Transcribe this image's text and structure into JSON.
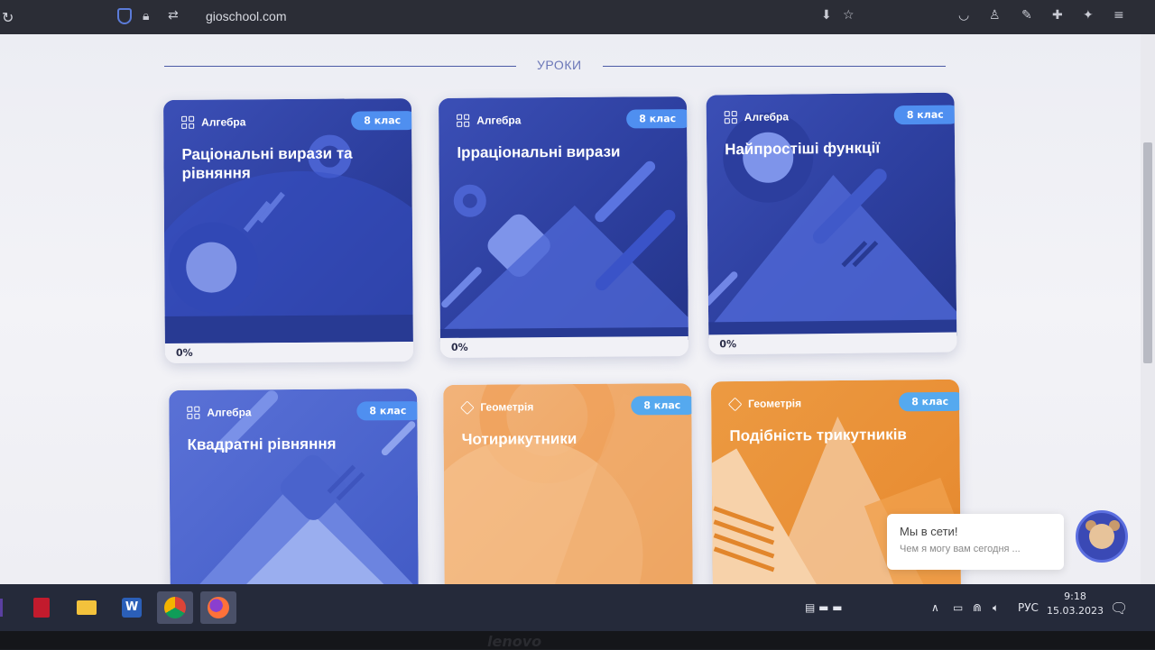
{
  "browser": {
    "url": "gioschool.com"
  },
  "section": {
    "title": "УРОКИ"
  },
  "cards": [
    {
      "subject": "Алгебра",
      "grade": "8 клас",
      "title": "Раціональні вирази та рівняння",
      "progress": "0%"
    },
    {
      "subject": "Алгебра",
      "grade": "8 клас",
      "title": "Ірраціональні вирази",
      "progress": "0%"
    },
    {
      "subject": "Алгебра",
      "grade": "8 клас",
      "title": "Найпростіші функції",
      "progress": "0%"
    },
    {
      "subject": "Алгебра",
      "grade": "8 клас",
      "title": "Квадратні рівняння"
    },
    {
      "subject": "Геометрія",
      "grade": "8 клас",
      "title": "Чотирикутники"
    },
    {
      "subject": "Геометрія",
      "grade": "8 клас",
      "title": "Подібність трикутників"
    }
  ],
  "chat": {
    "status": "Мы в сети!",
    "prompt": "Чем я могу вам сегодня ..."
  },
  "taskbar": {
    "lang": "РУС",
    "time": "9:18",
    "date": "15.03.2023",
    "apps": [
      "explorer-icon",
      "word-icon",
      "chrome-icon",
      "firefox-icon"
    ]
  },
  "colors": {
    "algebra": "#2d3f9f",
    "geometry": "#eea561",
    "grade_badge": "#4f8ff0"
  }
}
